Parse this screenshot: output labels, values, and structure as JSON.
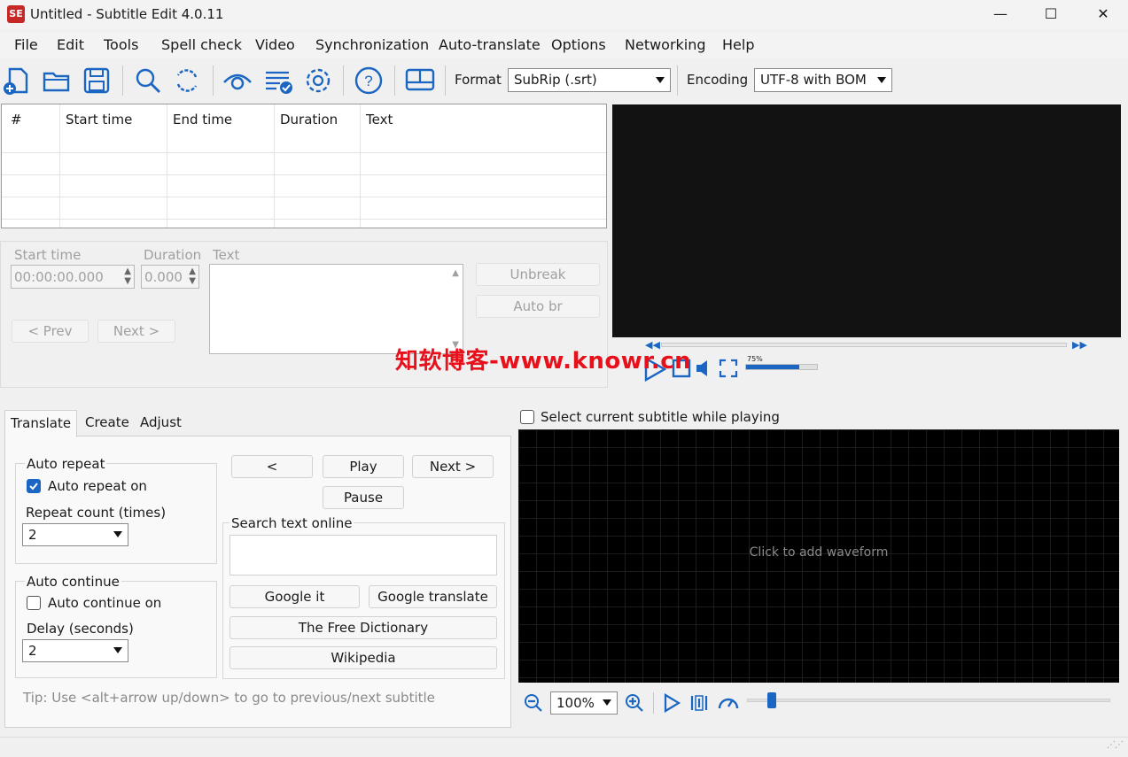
{
  "window": {
    "title": "Untitled - Subtitle Edit 4.0.11",
    "app_icon": "SE",
    "minimize": "—",
    "maximize": "☐",
    "close": "✕"
  },
  "menu": [
    "File",
    "Edit",
    "Tools",
    "Spell check",
    "Video",
    "Synchronization",
    "Auto-translate",
    "Options",
    "Networking",
    "Help"
  ],
  "toolbar": {
    "icons": [
      "new-file-icon",
      "open-folder-icon",
      "save-icon",
      "search-icon",
      "replace-icon",
      "eye-icon",
      "spellcheck-icon",
      "settings-icon",
      "help-icon",
      "layout-icon"
    ],
    "format_label": "Format",
    "format_value": "SubRip (.srt)",
    "encoding_label": "Encoding",
    "encoding_value": "UTF-8 with BOM"
  },
  "grid": {
    "columns": [
      "#",
      "Start time",
      "End time",
      "Duration",
      "Text"
    ]
  },
  "edit": {
    "start_time_label": "Start time",
    "duration_label": "Duration",
    "text_label": "Text",
    "start_time_value": "00:00:00.000",
    "duration_value": "0.000",
    "unbreak": "Unbreak",
    "auto_br": "Auto br",
    "prev": "< Prev",
    "next": "Next >"
  },
  "video": {
    "volume_percent": "75%",
    "watermark": "知软博客-www.knowr.cn"
  },
  "tabs": [
    "Translate",
    "Create",
    "Adjust"
  ],
  "translate": {
    "auto_repeat_group": "Auto repeat",
    "auto_repeat_on": "Auto repeat on",
    "repeat_count_label": "Repeat count (times)",
    "repeat_count_value": "2",
    "auto_continue_group": "Auto continue",
    "auto_continue_on": "Auto continue on",
    "delay_label": "Delay (seconds)",
    "delay_value": "2",
    "prev_btn": "<",
    "play_btn": "Play",
    "next_btn": "Next >",
    "pause_btn": "Pause",
    "search_group": "Search text online",
    "google_it": "Google it",
    "google_translate": "Google translate",
    "free_dictionary": "The Free Dictionary",
    "wikipedia": "Wikipedia",
    "tip": "Tip: Use <alt+arrow up/down> to go to previous/next subtitle"
  },
  "waveform": {
    "select_current": "Select current subtitle while playing",
    "click_to_add": "Click to add waveform",
    "zoom_value": "100%"
  },
  "colors": {
    "accent": "#1a66c2",
    "video_bg": "#121212",
    "watermark": "#e8101a"
  }
}
